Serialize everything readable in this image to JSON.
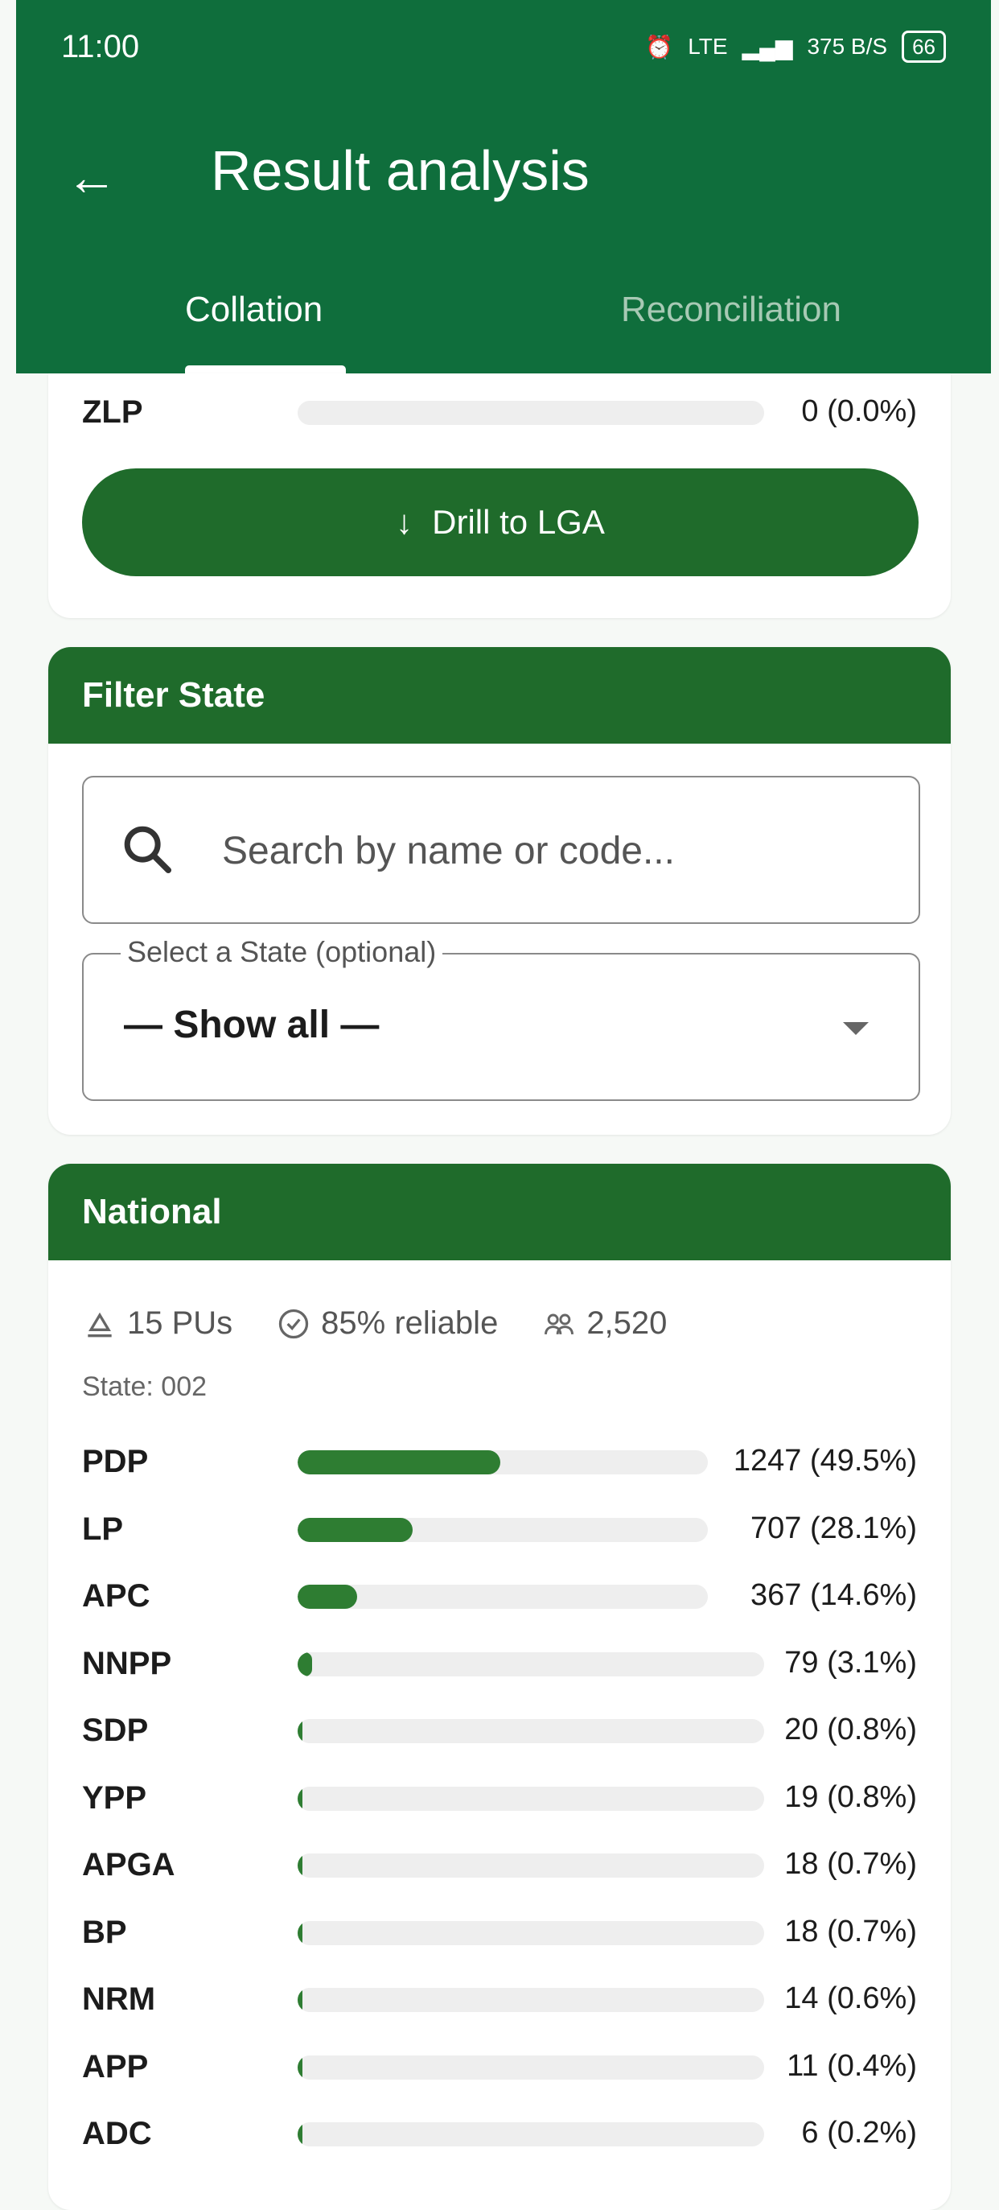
{
  "status_bar": {
    "time": "11:00",
    "network": "LTE",
    "speed": "375 B/S",
    "battery": "66"
  },
  "app_bar": {
    "title": "Result analysis",
    "tabs": [
      "Collation",
      "Reconciliation"
    ],
    "active_tab": "Collation"
  },
  "top_card": {
    "party_row": {
      "name": "ZLP",
      "value": "0 (0.0%)",
      "pct": 0.0
    },
    "drill_button": "Drill to LGA"
  },
  "filter_card": {
    "title": "Filter State",
    "search_placeholder": "Search by name or code...",
    "select_label": "Select a State (optional)",
    "select_value": "— Show all —"
  },
  "national_card": {
    "title": "National",
    "stats": {
      "pus": "15 PUs",
      "reliable": "85% reliable",
      "voters": "2,520"
    },
    "state_line": "State: 002",
    "parties": [
      {
        "name": "PDP",
        "value": "1247 (49.5%)",
        "pct": 49.5
      },
      {
        "name": "LP",
        "value": "707 (28.1%)",
        "pct": 28.1
      },
      {
        "name": "APC",
        "value": "367 (14.6%)",
        "pct": 14.6
      },
      {
        "name": "NNPP",
        "value": "79 (3.1%)",
        "pct": 3.1
      },
      {
        "name": "SDP",
        "value": "20 (0.8%)",
        "pct": 0.8
      },
      {
        "name": "YPP",
        "value": "19 (0.8%)",
        "pct": 0.8
      },
      {
        "name": "APGA",
        "value": "18 (0.7%)",
        "pct": 0.7
      },
      {
        "name": "BP",
        "value": "18 (0.7%)",
        "pct": 0.7
      },
      {
        "name": "NRM",
        "value": "14 (0.6%)",
        "pct": 0.6
      },
      {
        "name": "APP",
        "value": "11 (0.4%)",
        "pct": 0.4
      },
      {
        "name": "ADC",
        "value": "6 (0.2%)",
        "pct": 0.2
      }
    ]
  },
  "colors": {
    "primary": "#0f6e3c",
    "header": "#1f6b2b",
    "bar": "#2e7d32",
    "track": "#eeeeee"
  }
}
